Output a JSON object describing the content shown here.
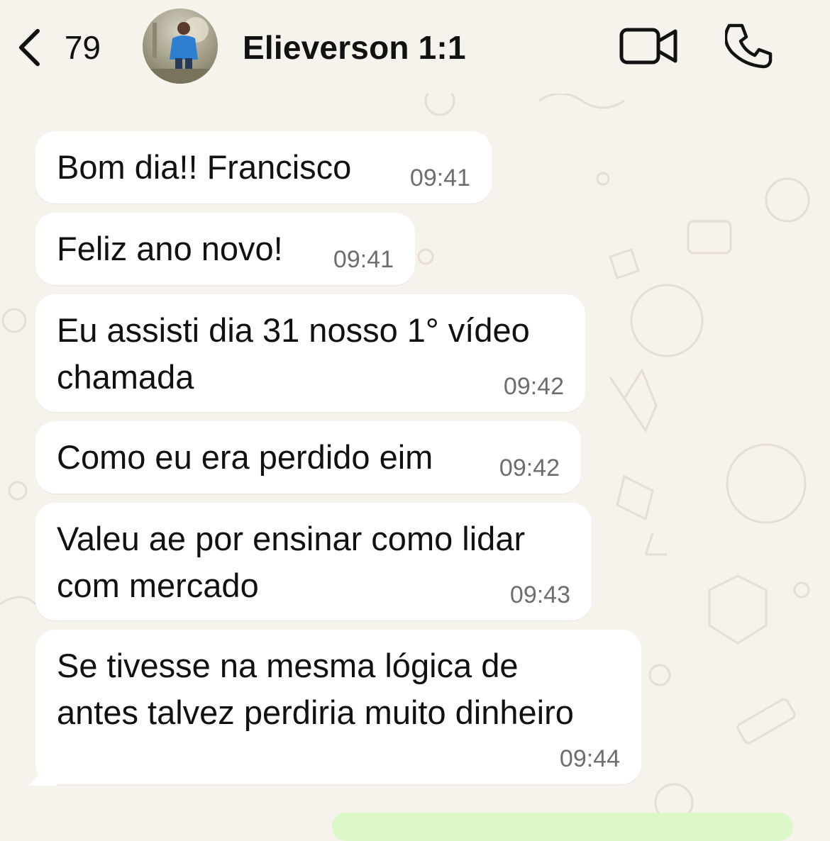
{
  "header": {
    "back_count": "79",
    "contact_name": "Elieverson 1:1"
  },
  "messages": [
    {
      "text": "Bom dia!! Francisco",
      "time": "09:41"
    },
    {
      "text": "Feliz ano novo!",
      "time": "09:41"
    },
    {
      "text": "Eu assisti dia 31 nosso 1° vídeo\nchamada",
      "time": "09:42"
    },
    {
      "text": "Como eu era perdido eim",
      "time": "09:42"
    },
    {
      "text": "Valeu ae por ensinar como lidar\ncom mercado",
      "time": "09:43"
    },
    {
      "text": "Se tivesse na mesma lógica de\nantes talvez perdiria muito dinheiro",
      "time": "09:44"
    }
  ],
  "icons": {
    "back": "chevron-left-icon",
    "video": "video-camera-icon",
    "call": "phone-icon"
  },
  "colors": {
    "background": "#F6F2EC",
    "bubble_incoming": "#FFFFFF",
    "bubble_outgoing": "#DCF8C6",
    "timestamp": "#6d6d6d"
  }
}
